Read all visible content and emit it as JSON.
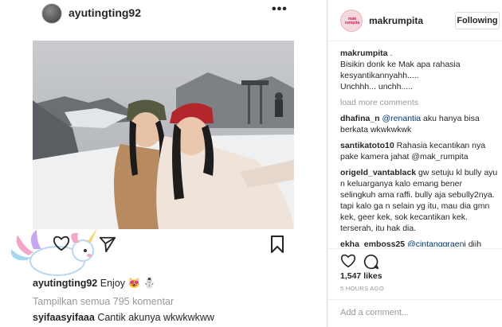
{
  "post": {
    "username": "ayutingting92",
    "more_icon": "more-horizontal-icon",
    "caption_text": "Enjoy 😻 ⛄",
    "view_all_comments": "Tampilkan semua 795 komentar",
    "first_comment": {
      "username": "syifaasyifaaa",
      "text": "Cantik akunya wkwkwkww"
    },
    "icons": [
      "heart-icon",
      "share-icon",
      "bookmark-icon"
    ]
  },
  "detail": {
    "username": "makrumpita",
    "avatar_text": "mak rumpita",
    "follow_label": "Following",
    "caption_username": "makrumpita",
    "caption_lines": [
      ".",
      "Bisikin donk ke Mak apa rahasia",
      "kesyantikannyahh.....",
      "Unchhh... unchh....."
    ],
    "load_more": "load more comments",
    "comments": [
      {
        "user": "dhafina_n",
        "mention": "@renantia",
        "text": " aku hanya bisa berkata wkwkwkwk"
      },
      {
        "user": "santikatoto10",
        "mention": "",
        "text": " Rahasia kecantikan nya pake kamera jahat @mak_rumpita"
      },
      {
        "user": "origeld_vantablack",
        "mention": "",
        "text": " gw setuju kl bully ayu n keluarganya kalo emang bener selingkuh ama raffi. bully aja sebully2nya. tapi kalo ga n selain yg itu, mau dia gmn kek, geer kek, sok kecantikan kek. terserah, itu hak dia."
      },
      {
        "user": "ekha_emboss25",
        "mention": "@cintanggraeni",
        "text": " diih orang aneh.. periksa deh sana ke RS jiwa apa mungkin lo baru kluaran ya jadi msh bloom stabil... doa orang jahat gak akan terijabah Cemisa itu"
      }
    ],
    "likes": "1,547 likes",
    "time": "5 HOURS AGO",
    "comment_placeholder": "Add a comment...",
    "icons": [
      "heart-icon",
      "comment-icon"
    ]
  }
}
